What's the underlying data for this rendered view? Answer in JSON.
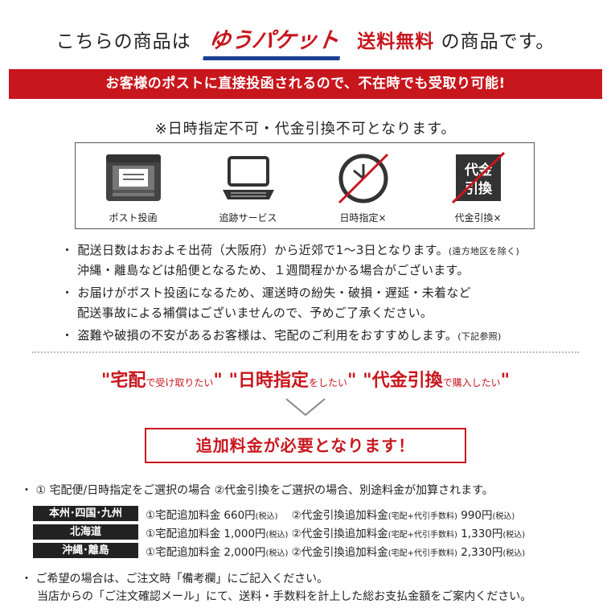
{
  "headline": {
    "prefix": "こちらの商品は",
    "brand": "ゆうパケット",
    "free": "送料無料",
    "suffix": "の商品です。"
  },
  "banner": "お客様のポストに直接投函されるので、不在時でも受取り可能!",
  "note": "※日時指定不可・代金引換不可となります。",
  "icons": [
    {
      "icon": "mailbox-icon",
      "label": "ポスト投函"
    },
    {
      "icon": "laptop-icon",
      "label": "追跡サービス"
    },
    {
      "icon": "clock-icon",
      "label": "日時指定×"
    },
    {
      "icon": "cod-icon",
      "label": "代金引換×",
      "glyph_top": "代金",
      "glyph_bottom": "引換"
    }
  ],
  "bullets": [
    {
      "line1": "配送日数はおおよそ出荷（大阪府）から近郊で1〜3日となります。",
      "line1_small": "(遠方地区を除く)",
      "line2": "沖縄・離島などは船便となるため、１週間程かかる場合がございます。"
    },
    {
      "line1": "お届けがポスト投函になるため、運送時の紛失・破損・遅延・未着など",
      "line2": "配送事故による補償はございませんので、予めご了承ください。"
    },
    {
      "line1": "盗難や破損の不安があるお客様は、宅配のご利用をおすすめします。",
      "line1_small": "(下記参照)"
    }
  ],
  "wants": [
    {
      "open": "\"",
      "big": "宅配",
      "small": "で受け取りたい",
      "close": "\""
    },
    {
      "open": "\"",
      "big": "日時指定",
      "small": "をしたい",
      "close": "\""
    },
    {
      "open": "\"",
      "big": "代金引換",
      "small": "で購入したい",
      "close": "\""
    }
  ],
  "additional": "追加料金が必要となります！",
  "fee_intro": "・ ① 宅配便/日時指定をご選択の場合 ②代金引換をご選択の場合、別途料金が加算されます。",
  "fee_rows": [
    {
      "region": "本州･四国･九州",
      "text_a": "①宅配追加料金 660円",
      "tax_a": "(税込)",
      "text_b": "②代金引換追加料金",
      "note_b": "(宅配+代引手数料)",
      "amount_b": "990円",
      "tax_b": "(税込)"
    },
    {
      "region": "北海道",
      "text_a": "①宅配追加料金 1,000円",
      "tax_a": "(税込)",
      "text_b": "②代金引換追加料金",
      "note_b": "(宅配+代引手数料)",
      "amount_b": "1,330円",
      "tax_b": "(税込)"
    },
    {
      "region": "沖縄･離島",
      "text_a": "①宅配追加料金 2,000円",
      "tax_a": "(税込)",
      "text_b": "②代金引換追加料金",
      "note_b": "(宅配+代引手数料)",
      "amount_b": "2,330円",
      "tax_b": "(税込)"
    }
  ],
  "footer": {
    "line1": "・ ご希望の場合は、ご注文時「備考欄」にご記入ください。",
    "line2": "当店からの「ご注文確認メール」にて、送料・手数料を計上した総お支払金額をご案内ください。"
  },
  "colors": {
    "accent": "#c8161d",
    "brand_blue": "#1b3f95",
    "dark": "#222222"
  }
}
